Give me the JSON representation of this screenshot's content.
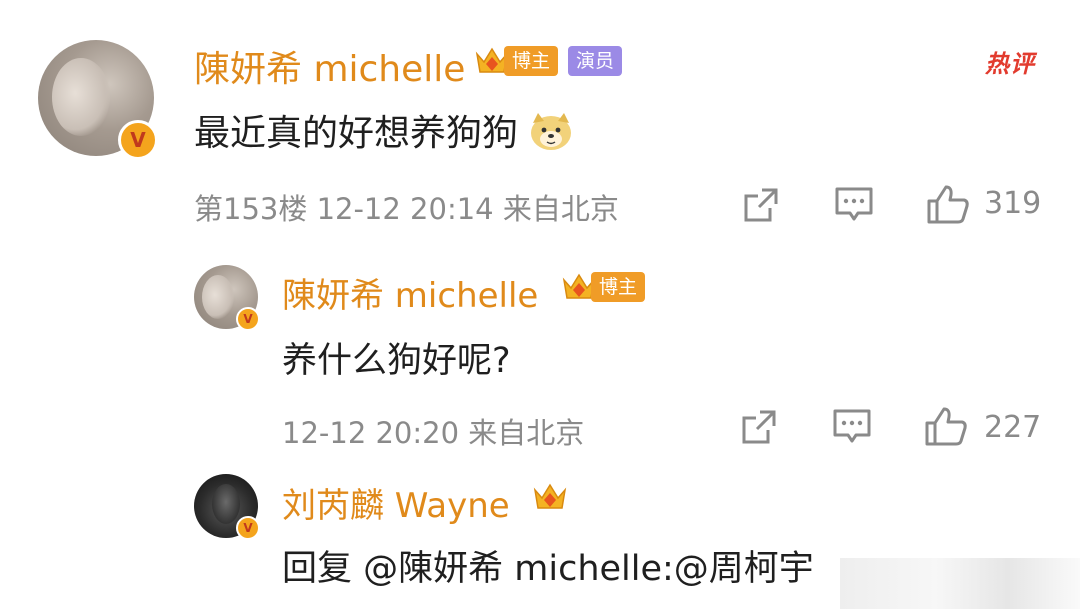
{
  "hot_label": "热评",
  "comments": [
    {
      "author": "陳妍希 michelle",
      "badges": [
        "博主",
        "演员"
      ],
      "text": "最近真的好想养狗狗",
      "emoji": "doge-emoji",
      "meta": "第153楼 12-12 20:14 来自北京",
      "likes": "319"
    },
    {
      "author": "陳妍希 michelle",
      "badges": [
        "博主"
      ],
      "text": "养什么狗好呢?",
      "meta": "12-12 20:20 来自北京",
      "likes": "227"
    },
    {
      "author": "刘芮麟 Wayne",
      "text": "回复 @陳妍希 michelle:@周柯宇"
    }
  ],
  "icons": {
    "share": "share-icon",
    "comment": "comment-icon",
    "like": "thumbs-up-icon",
    "verified": "verified-v-icon",
    "crown": "crown-icon"
  },
  "colors": {
    "name": "#e08a1b",
    "host_badge": "#f09c27",
    "actor_badge": "#9b8ae6",
    "hot": "#e23b2e",
    "meta": "#8a8a8a"
  }
}
